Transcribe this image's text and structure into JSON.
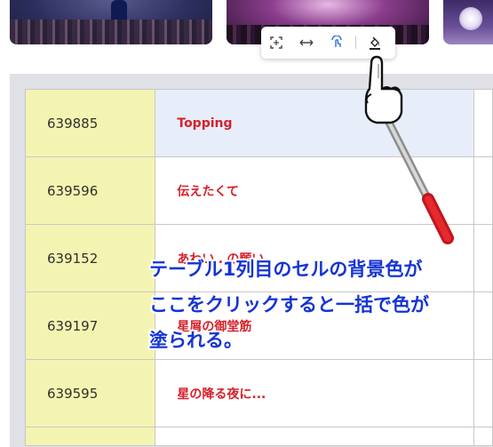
{
  "toolbar": {
    "buttons": [
      {
        "icon": "expand-icon"
      },
      {
        "icon": "fit-width-icon"
      },
      {
        "icon": "touch-select-icon"
      },
      {
        "icon": "fill-color-icon"
      }
    ],
    "accent": "#2f6fe0"
  },
  "table": {
    "rows": [
      {
        "id": "639885",
        "title": "Topping"
      },
      {
        "id": "639596",
        "title": "伝えたくて"
      },
      {
        "id": "639152",
        "title": "あわい…の願い"
      },
      {
        "id": "639197",
        "title": "星屑の御堂筋"
      },
      {
        "id": "639595",
        "title": "星の降る夜に..."
      }
    ],
    "id_column_color": "#f4f4b2",
    "title_color": "#d6212b"
  },
  "annotation": {
    "line1": "テーブル1列目のセルの背景色が",
    "line2": "ここをクリックすると一括で色が",
    "line3": "塗られる。",
    "color": "#1534d4"
  }
}
